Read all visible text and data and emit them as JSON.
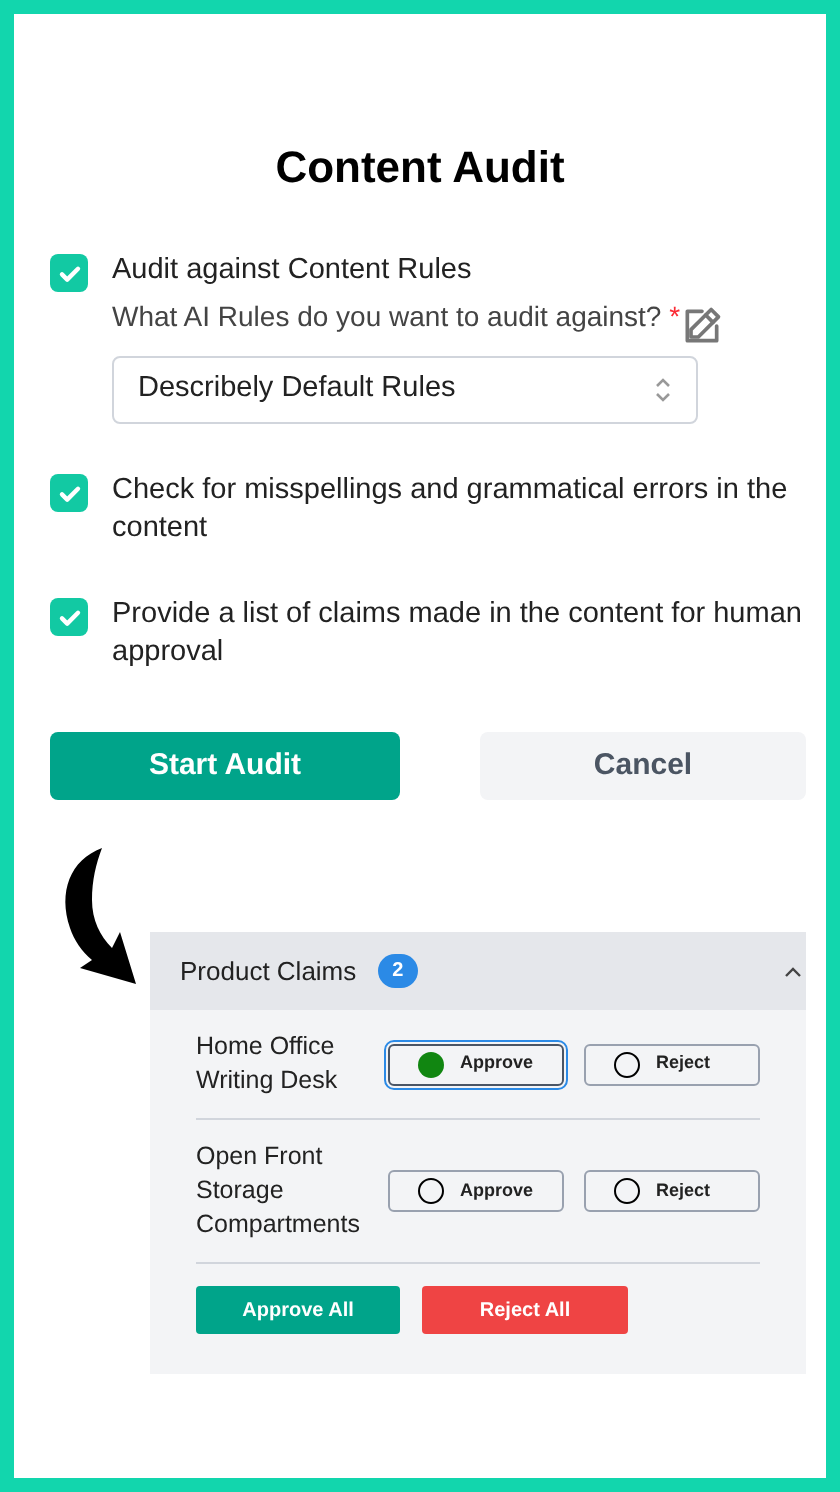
{
  "title": "Content Audit",
  "options": [
    {
      "label": "Audit against Content Rules",
      "checked": true,
      "field": {
        "label": "What AI Rules do you want to audit against?",
        "required_mark": "*",
        "value": "Describely Default Rules"
      }
    },
    {
      "label": "Check for misspellings and grammatical errors in the content",
      "checked": true
    },
    {
      "label": "Provide a list of claims made in the content for human approval",
      "checked": true
    }
  ],
  "buttons": {
    "primary": "Start Audit",
    "secondary": "Cancel"
  },
  "claims_panel": {
    "title": "Product Claims",
    "count": "2",
    "expanded": true,
    "claims": [
      {
        "name": "Home Office Writing Desk",
        "choices": [
          {
            "label": "Approve",
            "selected": true
          },
          {
            "label": "Reject",
            "selected": false
          }
        ]
      },
      {
        "name": "Open Front Storage Compartments",
        "choices": [
          {
            "label": "Approve",
            "selected": false
          },
          {
            "label": "Reject",
            "selected": false
          }
        ]
      }
    ],
    "approve_all": "Approve All",
    "reject_all": "Reject All"
  }
}
